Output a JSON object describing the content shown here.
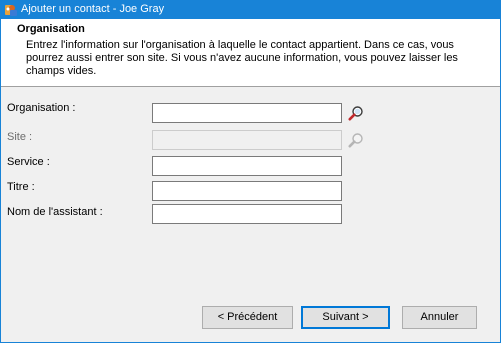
{
  "window": {
    "title": "Ajouter un contact - Joe Gray",
    "app_icon": "contact-app-icon"
  },
  "header": {
    "title": "Organisation",
    "description": "Entrez l'information sur l'organisation à laquelle le contact appartient. Dans ce cas, vous pourrez aussi entrer son site. Si vous n'avez aucune information, vous pouvez laisser les champs vides."
  },
  "form": {
    "organisation": {
      "label": "Organisation :",
      "value": "",
      "icon": "search-icon"
    },
    "site": {
      "label": "Site :",
      "value": "",
      "icon": "search-icon",
      "disabled": true
    },
    "service": {
      "label": "Service :",
      "value": ""
    },
    "titre": {
      "label": "Titre :",
      "value": ""
    },
    "assistant": {
      "label": "Nom de l'assistant :",
      "value": ""
    }
  },
  "buttons": {
    "previous": "< Précédent",
    "next": "Suivant >",
    "cancel": "Annuler"
  },
  "colors": {
    "titlebar": "#1883d7",
    "dialog_bg": "#f0f0f0",
    "header_bg": "#ffffff",
    "default_button_border": "#0078d7"
  }
}
